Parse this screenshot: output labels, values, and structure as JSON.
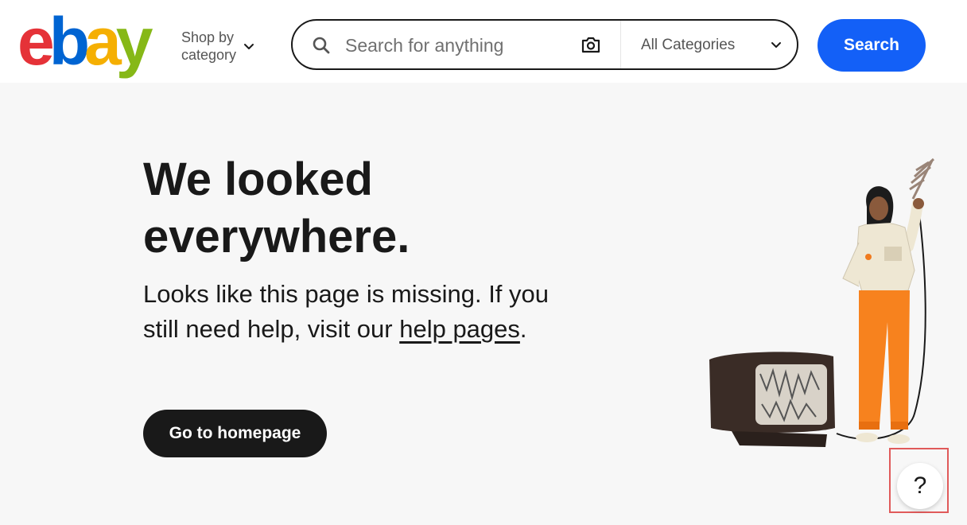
{
  "header": {
    "logo": {
      "letters": [
        {
          "char": "e",
          "color": "#e53238"
        },
        {
          "char": "b",
          "color": "#0064d2"
        },
        {
          "char": "a",
          "color": "#f5af02"
        },
        {
          "char": "y",
          "color": "#86b817"
        }
      ]
    },
    "shop_by": {
      "line1": "Shop by",
      "line2": "category"
    },
    "search": {
      "placeholder": "Search for anything",
      "category": "All Categories",
      "button_label": "Search"
    }
  },
  "main": {
    "title": "We looked everywhere.",
    "description_prefix": "Looks like this page is missing. If you still need help, visit our ",
    "help_link": "help pages",
    "description_suffix": ".",
    "home_button": "Go to homepage"
  },
  "help_button": {
    "label": "?"
  },
  "colors": {
    "accent": "#1360f7",
    "background": "#f7f7f7",
    "text": "#191919",
    "highlight": "#e05a5a"
  }
}
